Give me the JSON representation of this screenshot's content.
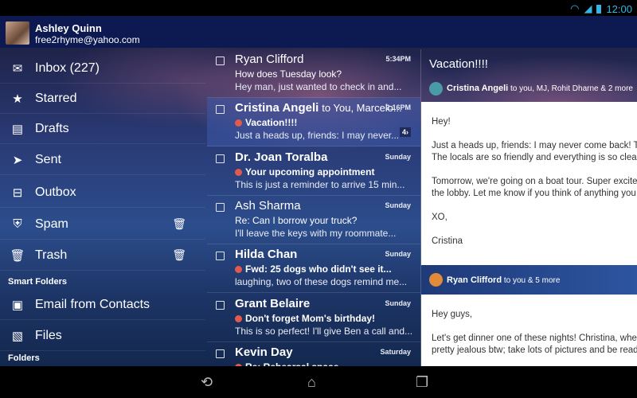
{
  "status": {
    "time": "12:00",
    "icons": [
      "wifi-icon",
      "signal-icon",
      "battery-icon"
    ]
  },
  "account": {
    "name": "Ashley Quinn",
    "email": "free2rhyme@yahoo.com"
  },
  "sidebar": {
    "items": [
      {
        "label": "Inbox (227)",
        "icon": "envelope-icon"
      },
      {
        "label": "Starred",
        "icon": "star-icon"
      },
      {
        "label": "Drafts",
        "icon": "drafts-icon"
      },
      {
        "label": "Sent",
        "icon": "send-icon"
      },
      {
        "label": "Outbox",
        "icon": "outbox-icon"
      },
      {
        "label": "Spam",
        "icon": "spam-icon"
      },
      {
        "label": "Trash",
        "icon": "trash-icon"
      }
    ],
    "smart_folders_header": "Smart Folders",
    "smart_folders": [
      {
        "label": "Email from Contacts",
        "icon": "contacts-icon"
      },
      {
        "label": "Files",
        "icon": "files-icon"
      }
    ],
    "folders_header": "Folders"
  },
  "emails": [
    {
      "from": "Ryan Clifford",
      "to": "",
      "time": "5:34PM",
      "subject": "How does Tuesday look?",
      "preview": "Hey man, just wanted to check in and...",
      "unread": false
    },
    {
      "from": "Cristina Angeli",
      "to": "to You, Marcelo...",
      "time": "2:16PM",
      "subject": "Vacation!!!!",
      "preview": "Just a heads up, friends: I may never...",
      "unread": true,
      "count": "4"
    },
    {
      "from": "Dr. Joan Toralba",
      "to": "",
      "time": "Sunday",
      "subject": "Your upcoming appointment",
      "preview": "This is just a reminder to arrive 15 min...",
      "unread": true
    },
    {
      "from": "Ash Sharma",
      "to": "",
      "time": "Sunday",
      "subject": "Re: Can I borrow your truck?",
      "preview": "I'll leave the keys with my roommate...",
      "unread": false
    },
    {
      "from": "Hilda Chan",
      "to": "",
      "time": "Sunday",
      "subject": "Fwd: 25 dogs who didn't see it...",
      "preview": "laughing, two of these dogs remind me...",
      "unread": true
    },
    {
      "from": "Grant Belaire",
      "to": "",
      "time": "Sunday",
      "subject": "Don't forget Mom's birthday!",
      "preview": "This is so perfect!  I'll give Ben a call and...",
      "unread": true
    },
    {
      "from": "Kevin Day",
      "to": "",
      "time": "Saturday",
      "subject": "Re: Rehearsal space",
      "preview": "",
      "unread": true
    }
  ],
  "reading": {
    "title": "Vacation!!!!",
    "messages": [
      {
        "sender": "Cristina Angeli",
        "recipients": "to you, MJ, Rohit Dharne & 2 more",
        "avatar_color": "#4a9aa8",
        "paragraphs": [
          "Hey!",
          "Just a heads up, friends: I may never come back! T\nThe locals are so friendly and everything is so clean",
          "Tomorrow, we're going on a boat tour. Super excite\nthe lobby. Let me know if you think of anything you",
          "XO,",
          "Cristina"
        ]
      },
      {
        "sender": "Ryan Clifford",
        "recipients": "to you & 5 more",
        "avatar_color": "#e08a3a",
        "paragraphs": [
          "Hey guys,",
          "Let's get dinner one of these nights! Christina, wher\npretty jealous btw; take lots of pictures and be read"
        ]
      }
    ]
  },
  "navbar": {
    "back": "back-icon",
    "home": "home-icon",
    "recents": "recents-icon"
  }
}
